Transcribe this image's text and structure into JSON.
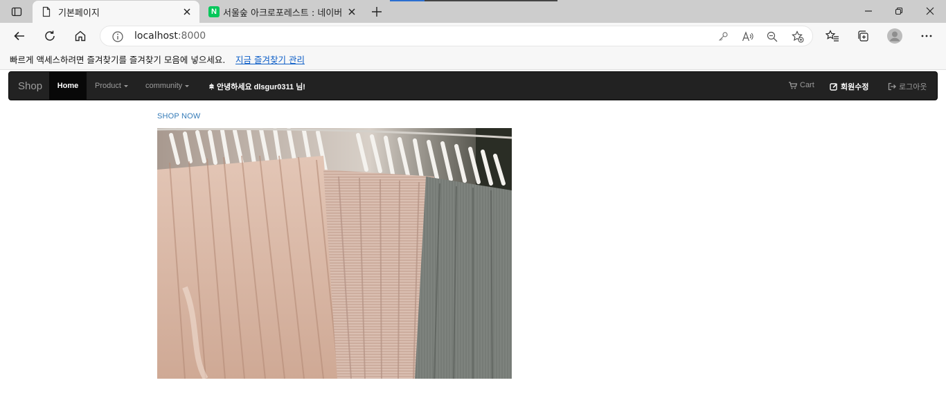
{
  "browser": {
    "tabs": [
      {
        "title": "기본페이지",
        "active": true
      },
      {
        "title": "서울숲 아크로포레스트 : 네이버",
        "active": false,
        "icon_letter": "N"
      }
    ],
    "address": {
      "host": "localhost",
      "port": ":8000"
    },
    "favorites_bar": {
      "message": "빠르게 액세스하려면 즐겨찾기를 즐겨찾기 모음에 넣으세요.",
      "link": "지금 즐겨찾기 관리"
    },
    "colors": {
      "naver_green": "#03c75a",
      "link_blue": "#0a5cc7"
    }
  },
  "navbar": {
    "brand": "Shop",
    "items": [
      {
        "label": "Home",
        "active": true
      },
      {
        "label": "Product",
        "dropdown": true
      },
      {
        "label": "community",
        "dropdown": true
      }
    ],
    "greeting": "안녕하세요 dlsgur0311 님!",
    "right": [
      {
        "label": "Cart",
        "icon": "shopping-cart-icon"
      },
      {
        "label": "회원수정",
        "icon": "edit-icon"
      },
      {
        "label": "로그아웃",
        "icon": "logout-icon"
      }
    ]
  },
  "content": {
    "shop_now": "SHOP NOW",
    "hero_alt": "clothing rack"
  }
}
